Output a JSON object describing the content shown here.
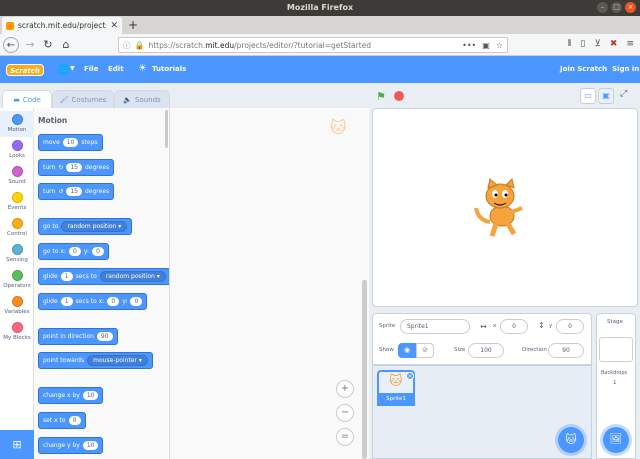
{
  "window": {
    "title": "Mozilla Firefox"
  },
  "browser": {
    "tab_title": "scratch.mit.edu/projects",
    "tab_close": "✕",
    "new_tab": "+",
    "url_prefix": "https://scratch.",
    "url_host": "mit.edu",
    "url_path": "/projects/editor/?tutorial=getStarted",
    "url_menu": "•••"
  },
  "menubar": {
    "logo": "Scratch",
    "file": "File",
    "edit": "Edit",
    "tutorials": "Tutorials",
    "join": "Join Scratch",
    "signin": "Sign in"
  },
  "tabs": {
    "code": "Code",
    "costumes": "Costumes",
    "sounds": "Sounds"
  },
  "categories": [
    {
      "label": "Motion",
      "color": "#4c97ff"
    },
    {
      "label": "Looks",
      "color": "#9966ff"
    },
    {
      "label": "Sound",
      "color": "#cf63cf"
    },
    {
      "label": "Events",
      "color": "#ffd500"
    },
    {
      "label": "Control",
      "color": "#ffab19"
    },
    {
      "label": "Sensing",
      "color": "#5cb1d6"
    },
    {
      "label": "Operators",
      "color": "#59c059"
    },
    {
      "label": "Variables",
      "color": "#ff8c1a"
    },
    {
      "label": "My Blocks",
      "color": "#ff6680"
    }
  ],
  "palette": {
    "title": "Motion",
    "move": {
      "a": "move",
      "v": "10",
      "b": "steps"
    },
    "turn_right": {
      "a": "turn",
      "v": "15",
      "b": "degrees"
    },
    "turn_left": {
      "a": "turn",
      "v": "15",
      "b": "degrees"
    },
    "goto": {
      "a": "go to",
      "dd": "random position"
    },
    "goto_xy": {
      "a": "go to x:",
      "x": "0",
      "b": "y:",
      "y": "0"
    },
    "glide_to": {
      "a": "glide",
      "v": "1",
      "b": "secs to",
      "dd": "random position"
    },
    "glide_xy": {
      "a": "glide",
      "v": "1",
      "b": "secs to x:",
      "x": "0",
      "c": "y:",
      "y": "0"
    },
    "point_dir": {
      "a": "point in direction",
      "v": "90"
    },
    "point_towards": {
      "a": "point towards",
      "dd": "mouse-pointer"
    },
    "change_x": {
      "a": "change x by",
      "v": "10"
    },
    "set_x": {
      "a": "set x to",
      "v": "0"
    },
    "change_y": {
      "a": "change y by",
      "v": "10"
    }
  },
  "zoom": {
    "in": "+",
    "out": "−",
    "reset": "="
  },
  "sprite": {
    "label": "Sprite",
    "name": "Sprite1",
    "x_label": "x",
    "x": "0",
    "y_label": "y",
    "y": "0",
    "show_label": "Show",
    "size_label": "Size",
    "size": "100",
    "direction_label": "Direction",
    "direction": "90",
    "tile_label": "Sprite1"
  },
  "stage_panel": {
    "title": "Stage",
    "backdrops_label": "Backdrops",
    "backdrops_count": "1"
  }
}
